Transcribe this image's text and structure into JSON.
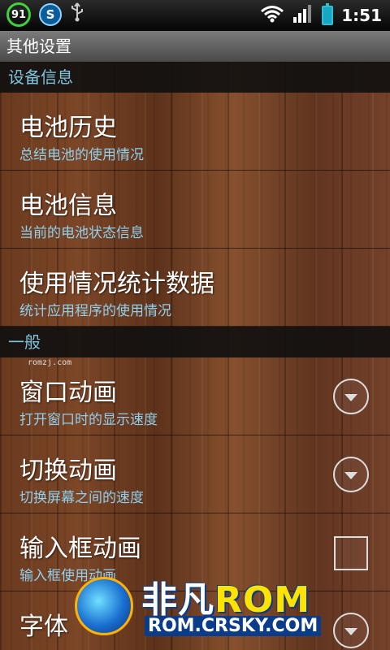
{
  "status_bar": {
    "battery_percent": "91",
    "app_icon_letter": "S",
    "usb_icon": "usb-icon",
    "wifi_icon": "wifi-icon",
    "signal_icon": "signal-icon",
    "battery_icon": "battery-charging-icon",
    "time": "1:51"
  },
  "title": "其他设置",
  "sections": [
    {
      "header": "设备信息",
      "items": [
        {
          "title": "电池历史",
          "summary": "总结电池的使用情况"
        },
        {
          "title": "电池信息",
          "summary": "当前的电池状态信息"
        },
        {
          "title": "使用情况统计数据",
          "summary": "统计应用程序的使用情况"
        }
      ]
    },
    {
      "header": "一般",
      "items": [
        {
          "title": "窗口动画",
          "summary": "打开窗口时的显示速度",
          "widget": "dropdown"
        },
        {
          "title": "切换动画",
          "summary": "切换屏幕之间的速度",
          "widget": "dropdown"
        },
        {
          "title": "输入框动画",
          "summary": "输入框使用动画",
          "widget": "checkbox",
          "checked": false
        },
        {
          "title": "字体",
          "summary": "",
          "widget": "dropdown"
        }
      ]
    }
  ],
  "watermarks": {
    "small_text": "romzj.com",
    "brand": "非凡",
    "brand_rom": "ROM",
    "url": "ROM.CRSKY.COM"
  },
  "colors": {
    "section_header_text": "#7fc4de",
    "summary_text": "#8fd0ee",
    "battery_ring": "#41d13a"
  }
}
